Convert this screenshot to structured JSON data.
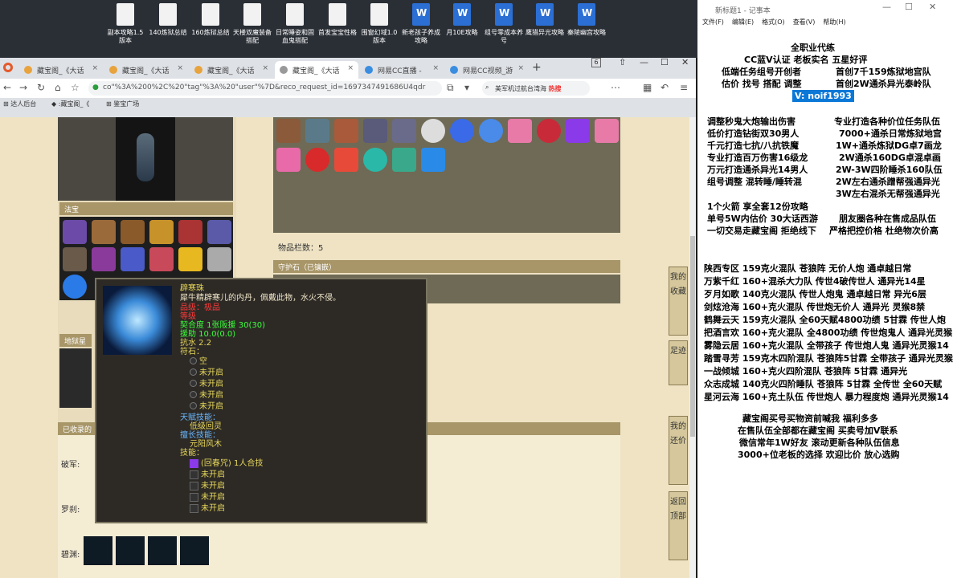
{
  "desktop": {
    "icons": [
      "副本攻略1.5版本",
      "140炼狱总结",
      "160炼狱总结",
      "天楼双魔装备搭配",
      "日常睡姿和固血鬼搭配",
      "首发宝宝性格",
      "围窗幻域1.0版本",
      "新老孩子养成攻略",
      "月10E攻略",
      "组号零成本养号",
      "鹰猎异光攻略",
      "秦陵幽宫攻略"
    ]
  },
  "browser": {
    "tabs": [
      "藏宝阁_《大话",
      "藏宝阁_《大话",
      "藏宝阁_《大话",
      "藏宝阁_《大话",
      "网易CC直播 - ",
      "网易CC视频_游"
    ],
    "tab_count": "6",
    "url": "co\"%3A%200%2C%20\"tag\"%3A%20\"user\"%7D&reco_request_id=1697347491686U4qdr",
    "search": "美军机过航台湾海",
    "hot": "热搜",
    "bookmarks": [
      "达人后台",
      ":藏宝阁_《",
      "鉴宝广场"
    ]
  },
  "game": {
    "section_fabao": "法宝",
    "section_diyu": "地狱星辰",
    "section_collected": "已收录的",
    "count_label": "物品栏数：5",
    "guard_label": "守护石（已镶嵌）",
    "row_labels": [
      "破军:",
      "罗刹:",
      "碧渊:"
    ],
    "side_buttons": [
      "我的收藏",
      "足迹",
      "我的还价",
      "返回顶部"
    ]
  },
  "tooltip": {
    "name": "辟寒珠",
    "desc": "犀牛精辟寒儿的内丹，佩戴此物，水火不侵。",
    "quality": "品级：极品",
    "equip": "等级",
    "fit": "契合度    1张阪援      30(30)",
    "assist": "援助    10.0(0.0)",
    "resist": "抗水 2.2",
    "rune_label": "符石：",
    "rune_slots": [
      "空",
      "未开启",
      "未开启",
      "未开启",
      "未开启"
    ],
    "talent_label": "天赋技能：",
    "talent": "低级回灵",
    "skill_label": "擅长技能：",
    "skill": "元阳风木",
    "skills_label": "技能：",
    "skill_list": [
      "(回春咒) 1人合技",
      "未开启",
      "未开启",
      "未开启",
      "未开启"
    ]
  },
  "notepad": {
    "title": "新标题1 - 记事本",
    "menu": [
      "文件(F)",
      "编辑(E)",
      "格式(O)",
      "查看(V)",
      "帮助(H)"
    ],
    "lines_top": [
      "全职业代练",
      "CC蓝V认证  老板实名  五星好评",
      "低端任务组号开创者",
      "首创7千159炼狱地宫队",
      "估价 找号 搭配 调整",
      "首创2W通杀异光泰岭队"
    ],
    "vx": "V:  noif1993",
    "lines_mid": [
      "调整秒鬼大炮输出伤害",
      "专业打造各种价位任务队伍",
      "低价打造钻街双30男人",
      "7000+通杀日常炼狱地宫",
      "千元打造七抗/八抗铁魔",
      "1W+通杀炼狱DG卓7画龙",
      "专业打造百万伤害16级龙",
      "2W通杀160DG卓混卓画",
      "万元打造通杀异光14男人",
      "2W-3W四阶睡杀160队伍",
      "组号调整 混转睡/睡转混",
      "2W左右通杀蹭帮强通异光",
      "3W左右混杀无帮强通异光",
      "1个火箭 享全套12份攻略",
      "单号5W内估价 30大话西游",
      "朋友圈各种在售成品队伍",
      "一切交易走藏宝阁 拒绝线下",
      "严格把控价格 杜绝物次价高"
    ],
    "lines_list": [
      "陕西专区 159克火混队 苍狼阵 无价人炮 通卓越日常",
      "万紫千红 160+混杀大力队 传世4破传世人 通异光14星",
      "歹月如歌 140克火混队 传世人炮鬼 通卓越日常 异光6层",
      "剑炫沧海 160+克火混队 传世炮无价人 通异光 灵猴8禁",
      "鹤舞云天 159克火混队 全60天赋4800功绩 5甘霖 传世人炮",
      "把酒言欢 160+克火混队 全4800功绩 传世炮鬼人 通异光灵猴",
      "雾隐云居 160+克火混队 全带孩子 传世炮人鬼 通异光灵猴14",
      "踏雪寻芳 159克木四阶混队 苍狼阵5甘霖 全带孩子 通异光灵猴",
      "一战倾城 160+克火四阶混队 苍狼阵 5甘霖 通异光",
      "众志成城 140克火四阶睡队 苍狼阵 5甘霖 全传世 全60天赋",
      "星河云海 160+克土队伍 传世炮人 暴力程度炮 通异光灵猴14"
    ],
    "lines_bottom": [
      "藏宝阁买号买物资前喊我 福利多多",
      "在售队伍全部都在藏宝阁 买卖号加V联系",
      "微信常年1W好友 滚动更新各种队伍信息",
      "3000+位老板的选择 欢迎比价 放心选购"
    ]
  }
}
